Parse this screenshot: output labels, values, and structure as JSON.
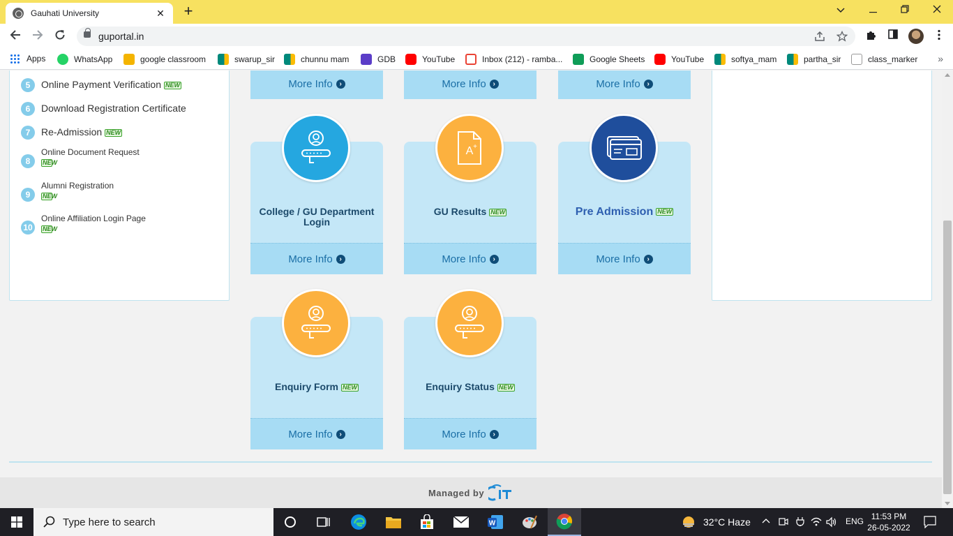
{
  "browser": {
    "tab_title": "Gauhati University",
    "tab_close": "✕",
    "new_tab": "+",
    "url": "guportal.in"
  },
  "bookmarks": [
    {
      "label": "Apps",
      "icon": "apps-grid-icon",
      "color": "#1a73e8"
    },
    {
      "label": "WhatsApp",
      "icon": "whatsapp-icon",
      "color": "#25d366"
    },
    {
      "label": "google classroom",
      "icon": "classroom-icon",
      "color": "#f4b400"
    },
    {
      "label": "swarup_sir",
      "icon": "meet-icon",
      "color": "#00897b"
    },
    {
      "label": "chunnu mam",
      "icon": "meet-icon",
      "color": "#00897b"
    },
    {
      "label": "GDB",
      "icon": "gdb-icon",
      "color": "#5b3dc8"
    },
    {
      "label": "YouTube",
      "icon": "youtube-icon",
      "color": "#ff0000"
    },
    {
      "label": "Inbox (212) - ramba...",
      "icon": "gmail-icon",
      "color": "#ea4335"
    },
    {
      "label": "Google Sheets",
      "icon": "sheets-icon",
      "color": "#0f9d58"
    },
    {
      "label": "YouTube",
      "icon": "youtube-icon",
      "color": "#ff0000"
    },
    {
      "label": "softya_mam",
      "icon": "meet-icon",
      "color": "#00897b"
    },
    {
      "label": "partha_sir",
      "icon": "meet-icon",
      "color": "#00897b"
    },
    {
      "label": "class_marker",
      "icon": "classmarker-icon",
      "color": "#d93025"
    }
  ],
  "bookmarks_more": "»",
  "menu": {
    "items": [
      {
        "num": "5",
        "label": "Online Payment Verification",
        "badge": "NEW"
      },
      {
        "num": "6",
        "label": "Download Registration Certificate",
        "badge": ""
      },
      {
        "num": "7",
        "label": "Re-Admission",
        "badge": "NEW"
      },
      {
        "num": "8",
        "label": "Online Document Request",
        "badge": "NEW"
      },
      {
        "num": "9",
        "label": "Alumni Registration",
        "badge": "NEW"
      },
      {
        "num": "10",
        "label": "Online Affiliation Login Page",
        "badge": "NEW"
      }
    ]
  },
  "cards": {
    "more_info": "More Info",
    "college_login": {
      "title": "College / GU Department Login",
      "icon": "user-key-icon",
      "color": "#25a7e0"
    },
    "gu_results": {
      "title": "GU Results",
      "badge": "NEW",
      "icon": "grade-document-icon",
      "color": "#fcb13f"
    },
    "pre_admission": {
      "title": "Pre Admission",
      "badge": "NEW",
      "icon": "id-card-icon",
      "color": "#1f4e9c"
    },
    "enquiry_form": {
      "title": "Enquiry Form",
      "badge": "NEW",
      "icon": "user-key-icon",
      "color": "#fcb13f"
    },
    "enquiry_status": {
      "title": "Enquiry Status",
      "badge": "NEW",
      "icon": "user-key-icon",
      "color": "#fcb13f"
    }
  },
  "footer": {
    "managed_by": "Managed by",
    "logo_text": "CIT"
  },
  "taskbar": {
    "search_placeholder": "Type here to search",
    "weather": "32°C  Haze",
    "language": "ENG",
    "time": "11:53 PM",
    "date": "26-05-2022"
  }
}
